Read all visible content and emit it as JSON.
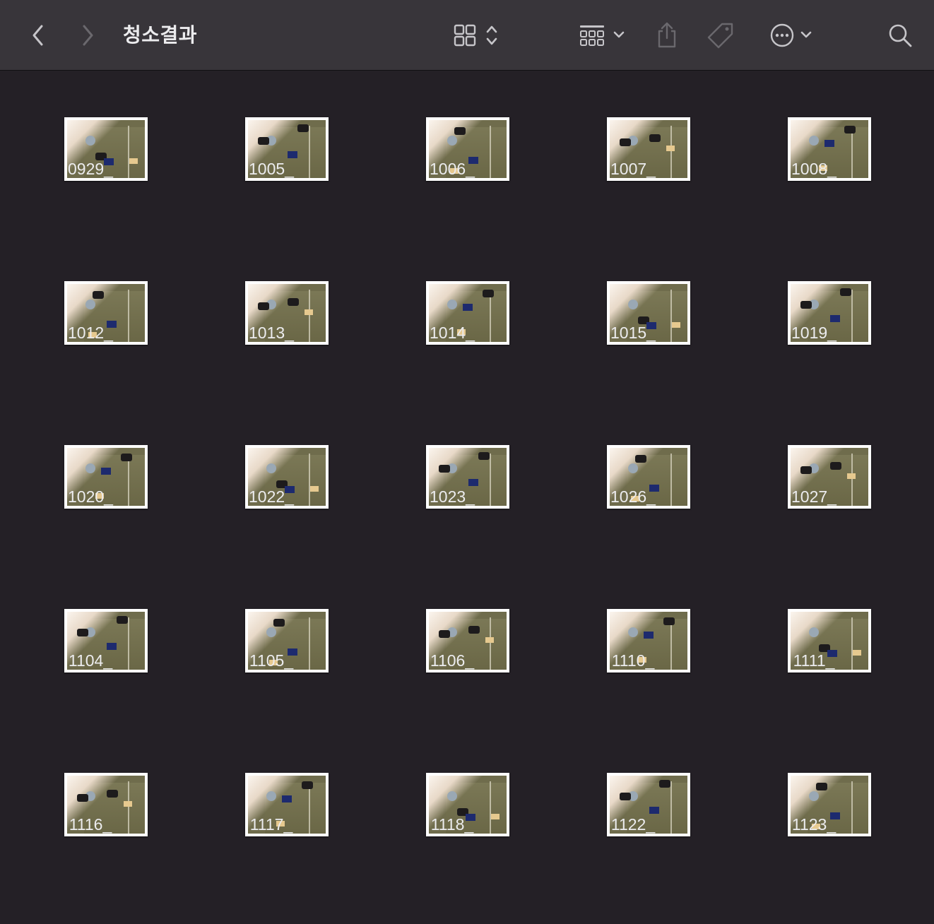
{
  "toolbar": {
    "folder_title": "청소결과",
    "icons": [
      "chevron-left-icon",
      "chevron-right-icon",
      "icon-view-grid-icon",
      "sort-updown-icon",
      "group-grid-icon",
      "chevron-down-icon",
      "share-icon",
      "tag-icon",
      "more-ellipsis-icon",
      "chevron-down-icon",
      "search-icon"
    ]
  },
  "files": [
    {
      "name": "0929_"
    },
    {
      "name": "1005_"
    },
    {
      "name": "1006_"
    },
    {
      "name": "1007_"
    },
    {
      "name": "1008_"
    },
    {
      "name": "1012_"
    },
    {
      "name": "1013_"
    },
    {
      "name": "1014_"
    },
    {
      "name": "1015_"
    },
    {
      "name": "1019_"
    },
    {
      "name": "1020_"
    },
    {
      "name": "1022_"
    },
    {
      "name": "1023_"
    },
    {
      "name": "1026_"
    },
    {
      "name": "1027_"
    },
    {
      "name": "1104_"
    },
    {
      "name": "1105_"
    },
    {
      "name": "1106_"
    },
    {
      "name": "1110_"
    },
    {
      "name": "1111_"
    },
    {
      "name": "1116_"
    },
    {
      "name": "1117_"
    },
    {
      "name": "1118_"
    },
    {
      "name": "1122_"
    },
    {
      "name": "1123_"
    }
  ],
  "colors": {
    "background": "#242026",
    "toolbar": "#38353a",
    "text": "#ececee",
    "icon": "#bdbcc0",
    "icon_disabled": "#6a686d"
  }
}
